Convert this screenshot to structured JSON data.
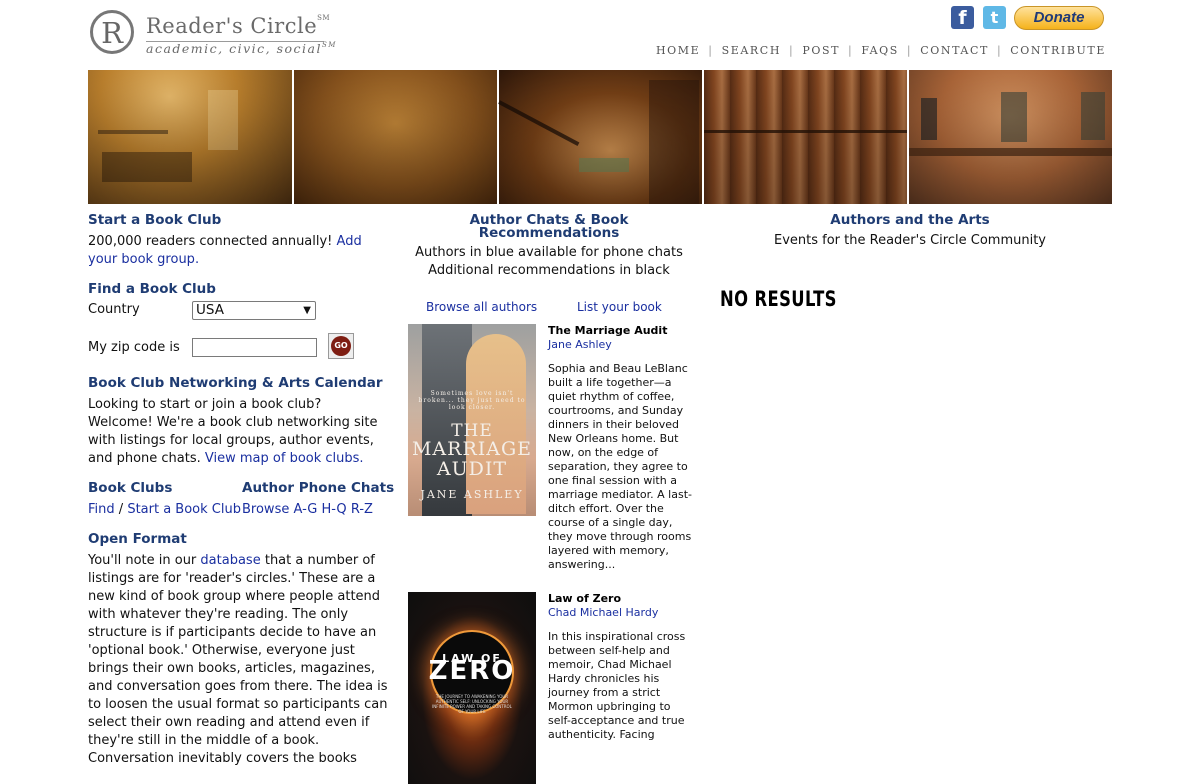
{
  "header": {
    "logo_letter": "R",
    "logo_title": "Reader's Circle",
    "logo_sm1": "SM",
    "logo_tagline": "academic, civic, social",
    "logo_sm2": "SM",
    "donate_label": "Donate",
    "nav": [
      "HOME",
      "SEARCH",
      "POST",
      "FAQS",
      "CONTACT",
      "CONTRIBUTE"
    ],
    "icons": [
      "facebook-icon",
      "twitter-icon"
    ]
  },
  "left": {
    "start": {
      "title": "Start a Book Club",
      "text": "200,000 readers connected annually!",
      "link": "Add your book group."
    },
    "find": {
      "title": "Find a Book Club",
      "country_label": "Country",
      "country_value": "USA",
      "zip_label": "My zip code is",
      "zip_value": "",
      "go_label": "GO"
    },
    "networking": {
      "title": "Book Club Networking & Arts Calendar",
      "text": "Looking to start or join a book club? Welcome! We're a book club networking site with listings for local groups, author events, and phone chats.",
      "link": "View map of book clubs."
    },
    "clubs": {
      "title": "Book Clubs",
      "find": "Find",
      "slash": "/",
      "start": "Start a Book Club"
    },
    "phone": {
      "title": "Author Phone Chats",
      "browse": "Browse",
      "r1": "A-G",
      "r2": "H-Q",
      "r3": "R-Z"
    },
    "open": {
      "title": "Open Format",
      "pre": "You'll note in our",
      "link": "database",
      "post": "that a number of listings are for 'reader's circles.' These are a new kind of book group where people attend with whatever they're reading. The only structure is if participants decide to have an 'optional book.' Otherwise, everyone just brings their own books, articles, magazines, and conversation goes from there. The idea is to loosen the usual format so participants can select their own reading and attend even if they're still in the middle of a book. Conversation inevitably covers the books"
    }
  },
  "middle": {
    "title": "Author Chats & Book Recommendations",
    "line1": "Authors in blue available for phone chats",
    "line2": "Additional recommendations in black",
    "browse_link": "Browse all authors",
    "list_link": "List your book",
    "books": [
      {
        "title": "The Marriage Audit",
        "author": "Jane Ashley",
        "desc": "Sophia and Beau LeBlanc built a life together—a quiet rhythm of coffee, courtrooms, and Sunday dinners in their beloved New Orleans home. But now, on the edge of separation, they agree to one final session with a marriage mediator. A last-ditch effort. Over the course of a single day, they move through rooms layered with memory, answering...",
        "cover_tag": "Sometimes love isn't broken... they just need to look closer.",
        "cover_t1": "THE",
        "cover_t2": "MARRIAGE",
        "cover_t3": "AUDIT",
        "cover_author": "JANE ASHLEY"
      },
      {
        "title": "Law of Zero",
        "author": "Chad Michael Hardy",
        "desc": "In this inspirational cross between self-help and memoir, Chad Michael Hardy chronicles his journey from a strict Mormon upbringing to self-acceptance and true authenticity. Facing",
        "cover_t1": "LAW OF",
        "cover_t2": "ZERO",
        "cover_sub": "THE JOURNEY TO AWAKENING YOUR AUTHENTIC SELF: UNLOCKING YOUR INFINITE POWER AND TAKING CONTROL OF YOUR LIFE"
      }
    ]
  },
  "right": {
    "title": "Authors and the Arts",
    "subtitle": "Events for the Reader's Circle Community",
    "no_results": "NO RESULTS"
  },
  "colors": {
    "heading": "#1f3c73",
    "link": "#1a2fa0",
    "donate": "#f5b21b"
  }
}
